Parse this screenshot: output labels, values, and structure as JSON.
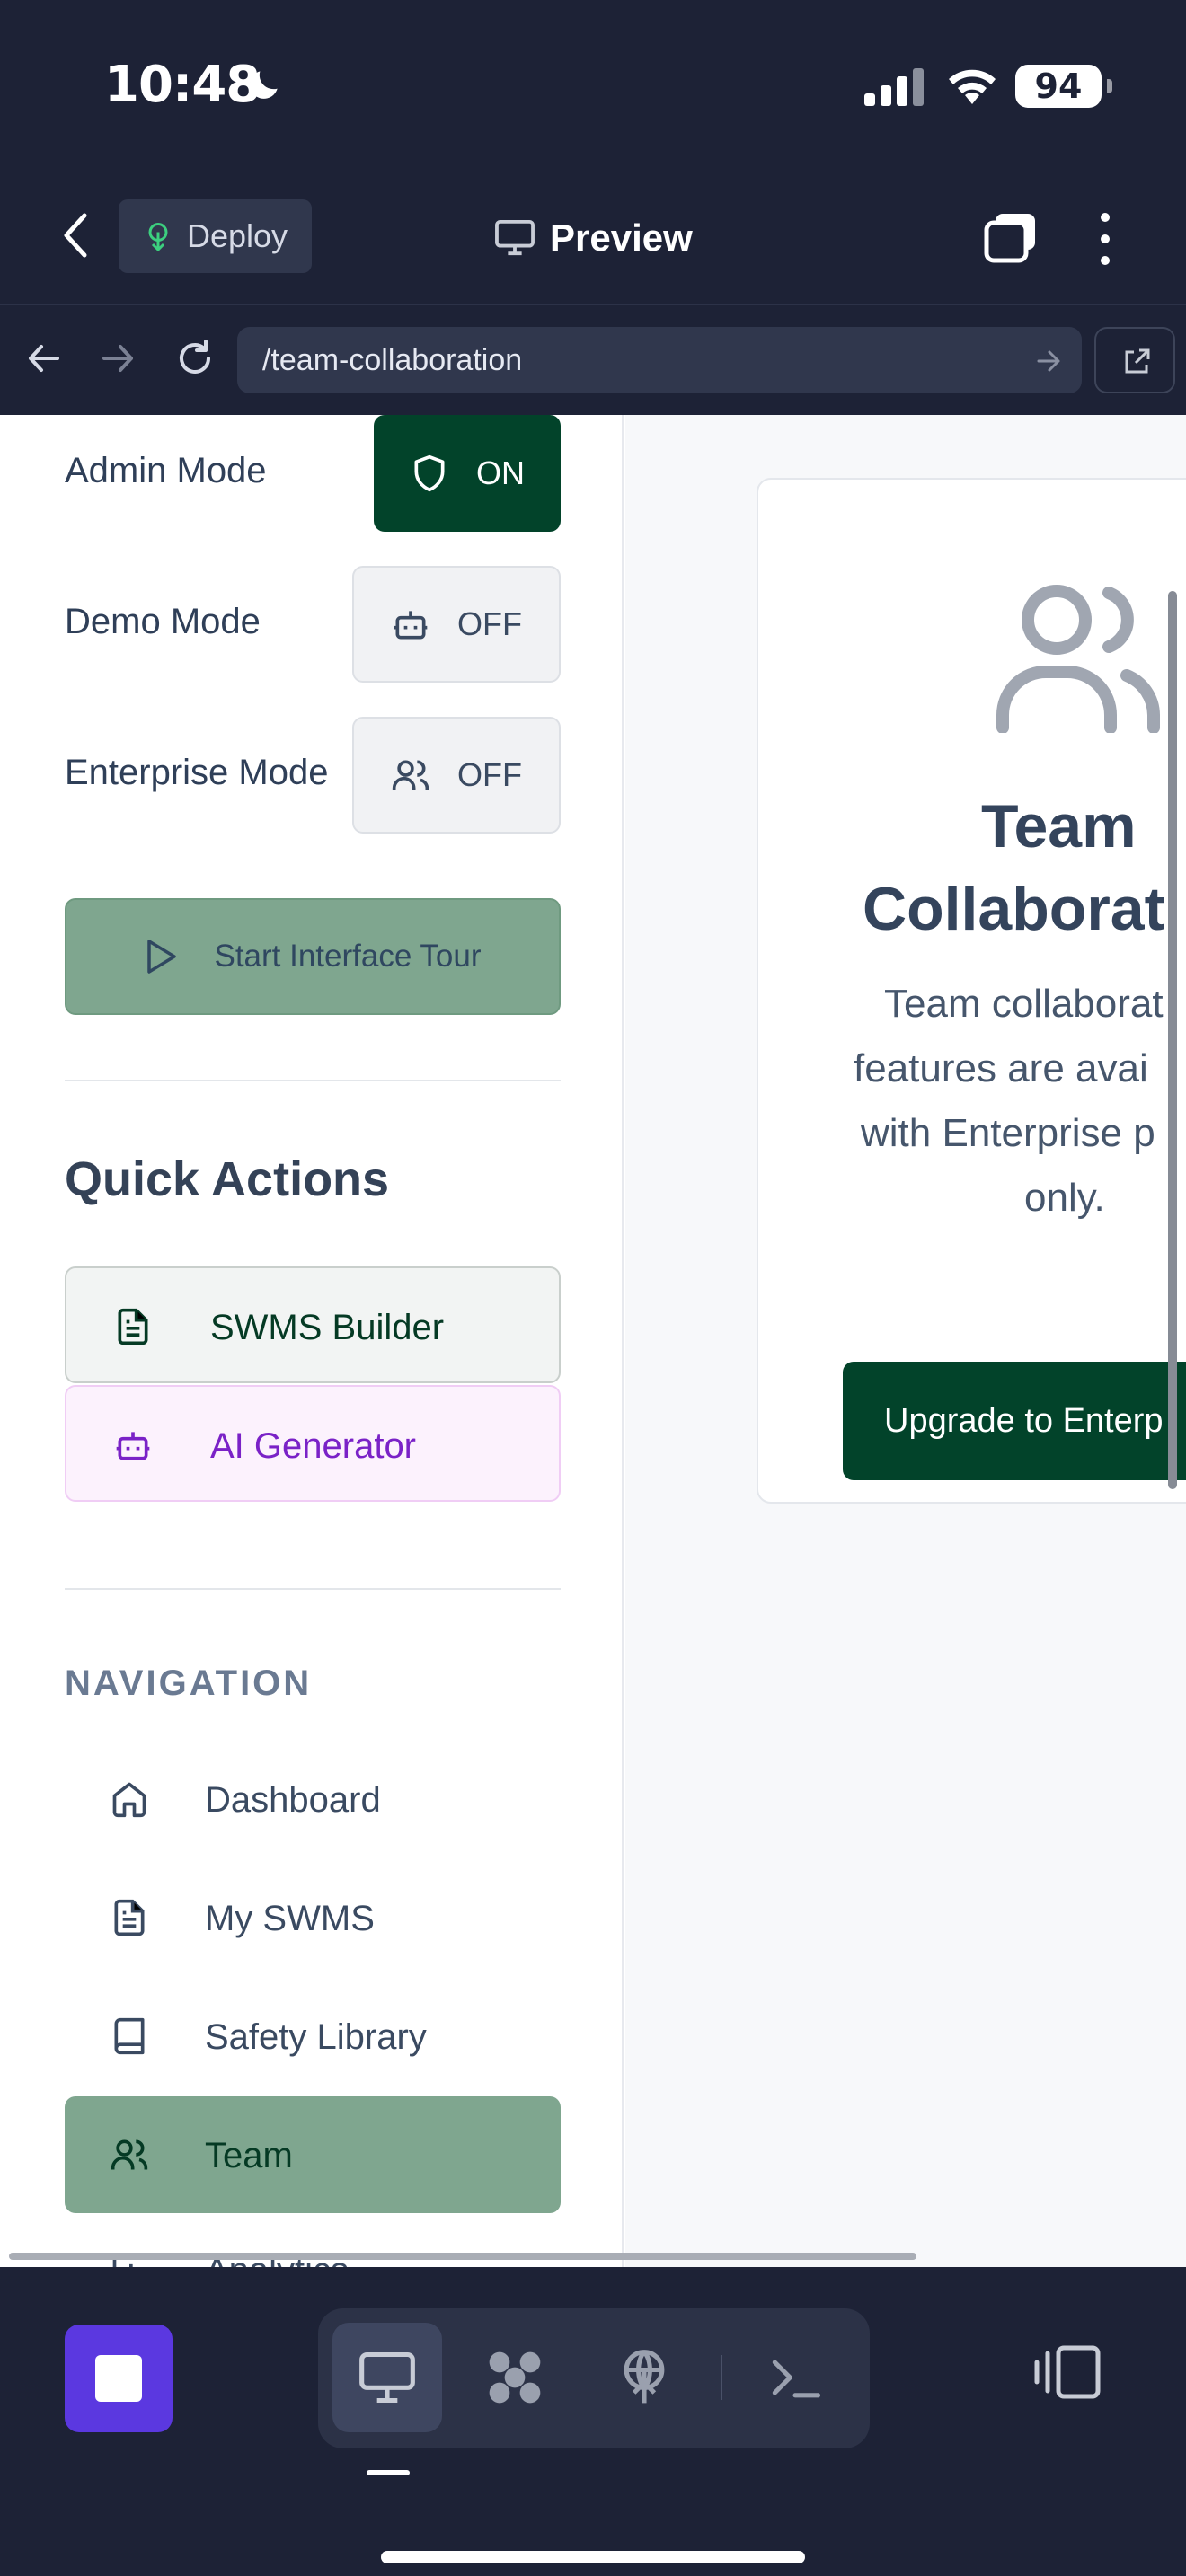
{
  "status_bar": {
    "time": "10:48",
    "battery": "94"
  },
  "toolbar": {
    "deploy_label": "Deploy",
    "preview_label": "Preview"
  },
  "browser": {
    "url": "/team-collaboration"
  },
  "sidebar": {
    "modes": [
      {
        "label": "Admin Mode",
        "state": "ON",
        "icon": "shield-icon"
      },
      {
        "label": "Demo Mode",
        "state": "OFF",
        "icon": "bot-icon"
      },
      {
        "label": "Enterprise Mode",
        "state": "OFF",
        "icon": "users-icon"
      }
    ],
    "tour_label": "Start Interface Tour",
    "quick_actions_title": "Quick Actions",
    "quick_actions": [
      {
        "label": "SWMS Builder",
        "icon": "file-text-icon"
      },
      {
        "label": "AI Generator",
        "icon": "bot-icon"
      }
    ],
    "navigation_title": "NAVIGATION",
    "nav_items": [
      {
        "label": "Dashboard",
        "icon": "home-icon"
      },
      {
        "label": "My SWMS",
        "icon": "file-text-icon"
      },
      {
        "label": "Safety Library",
        "icon": "book-icon"
      },
      {
        "label": "Team",
        "icon": "users-icon",
        "active": true
      },
      {
        "label": "Analytics",
        "icon": "chart-icon"
      }
    ]
  },
  "card": {
    "title_line1": "Team",
    "title_line2": "Collaborat",
    "text_line1": "Team collaborat",
    "text_line2": "features are avai",
    "text_line3": "with Enterprise p",
    "text_line4": "only.",
    "button_label": "Upgrade to Enterp"
  },
  "colors": {
    "brand_green": "#02432a",
    "active_nav": "#7fa68f",
    "accent_purple": "#5b38e0",
    "chrome_bg": "#1d2236"
  }
}
